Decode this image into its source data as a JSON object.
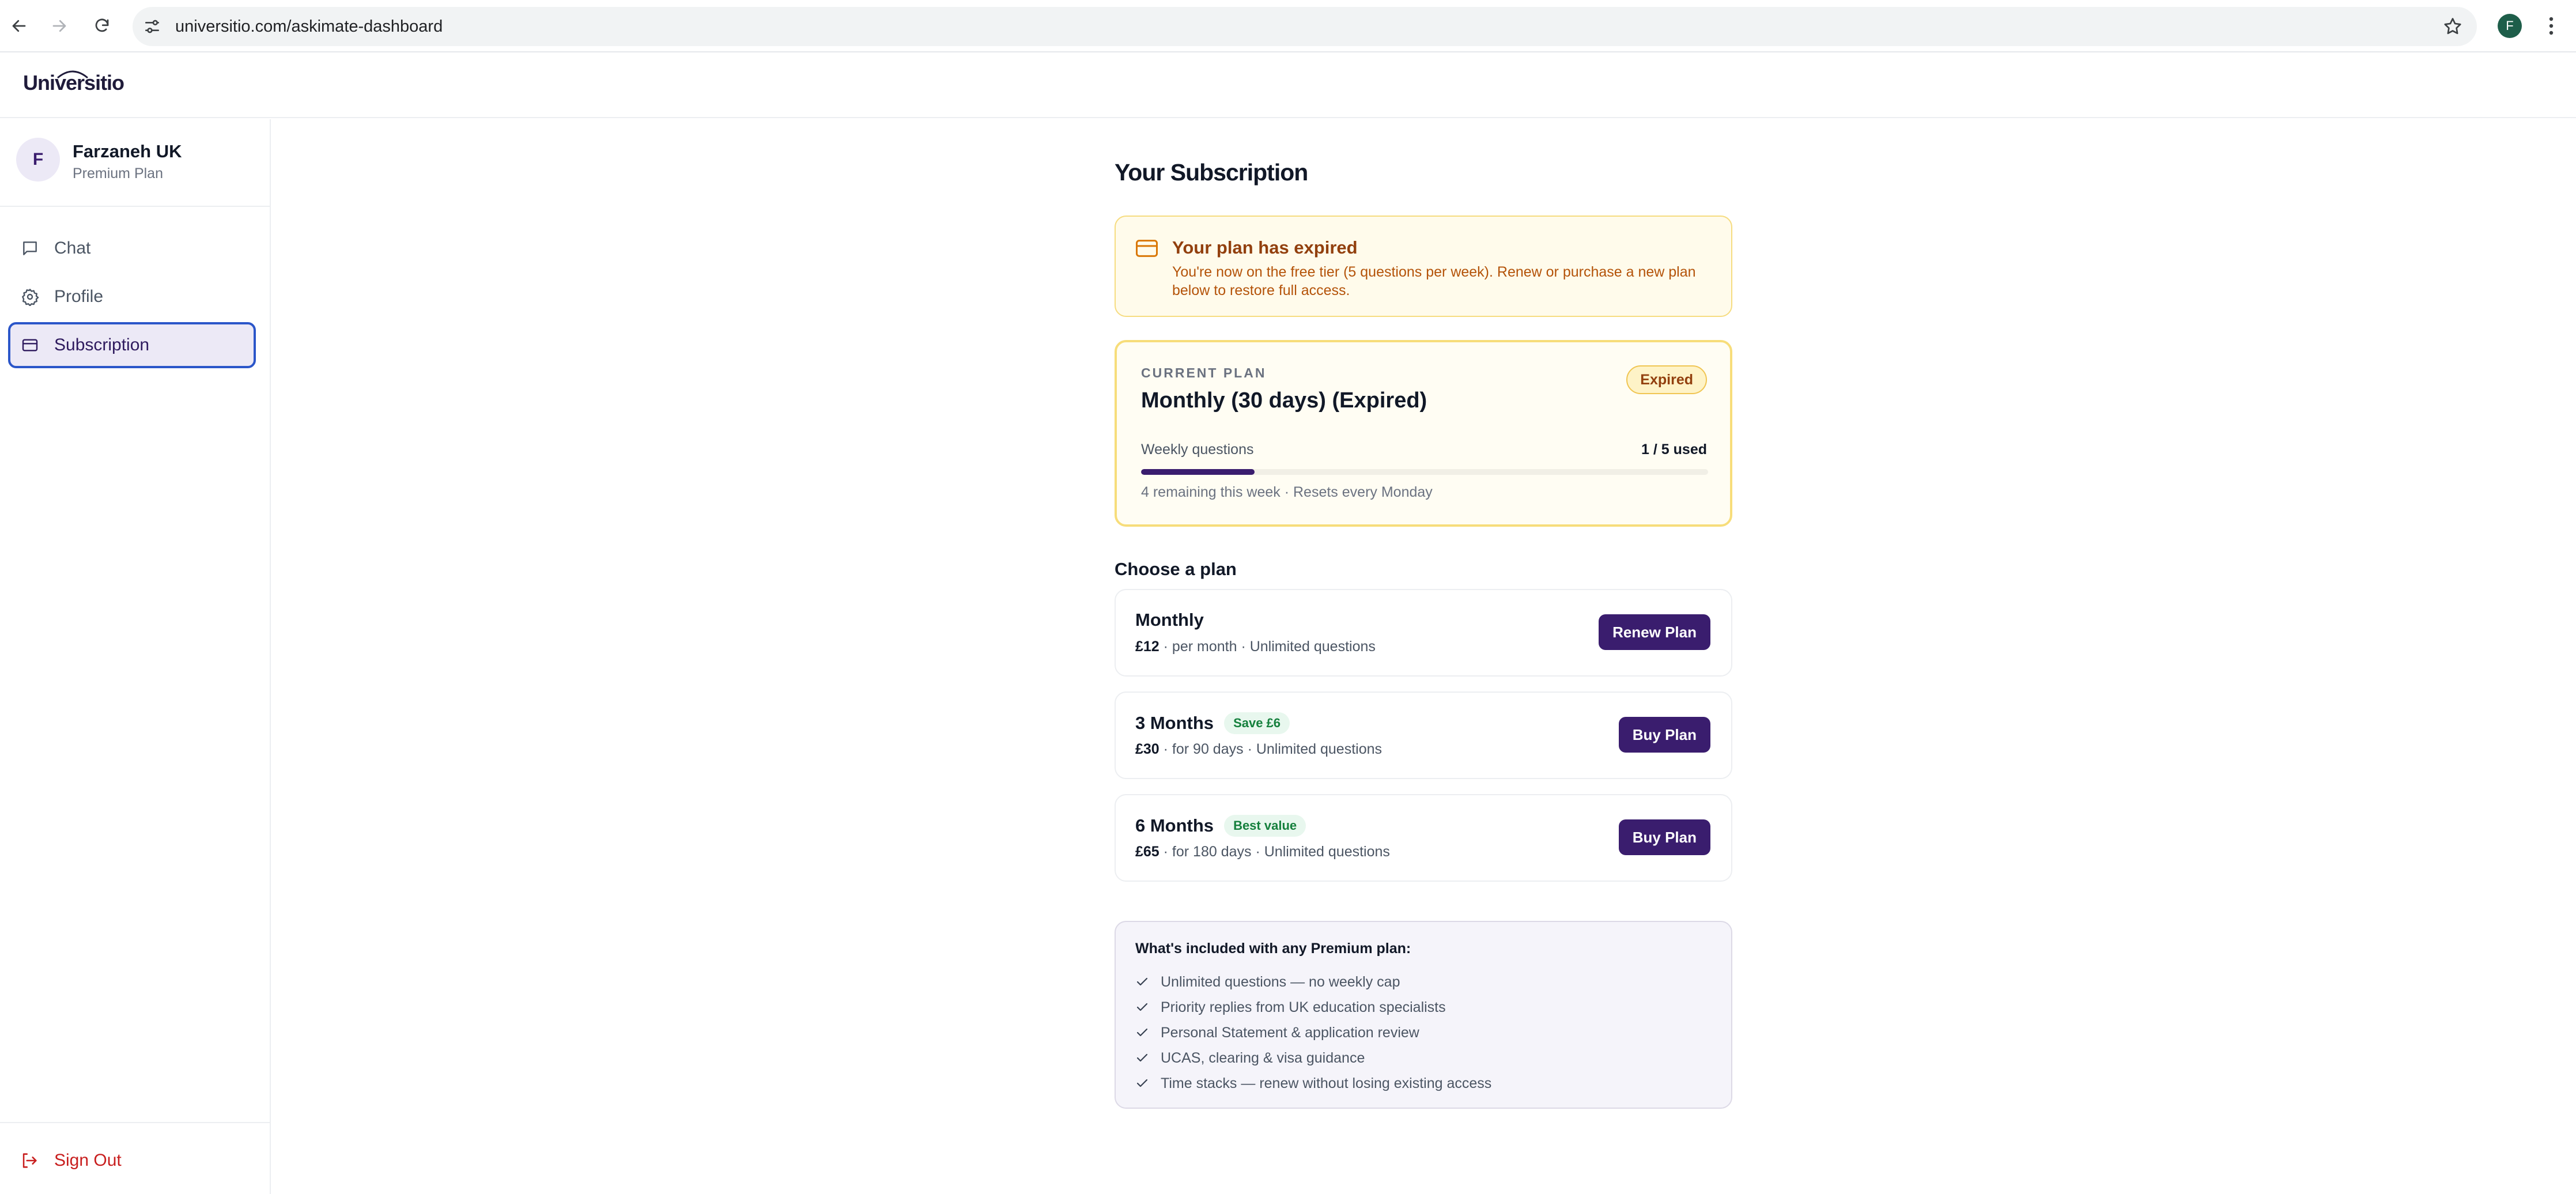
{
  "browser": {
    "url": "universitio.com/askimate-dashboard",
    "profile_initial": "F"
  },
  "app": {
    "logo": "Universitio"
  },
  "sidebar": {
    "user": {
      "initial": "F",
      "name": "Farzaneh UK",
      "plan": "Premium Plan"
    },
    "items": [
      {
        "label": "Chat",
        "icon": "chat-bubble-icon"
      },
      {
        "label": "Profile",
        "icon": "gear-icon"
      },
      {
        "label": "Subscription",
        "icon": "credit-card-icon"
      }
    ],
    "signout_label": "Sign Out"
  },
  "subscription": {
    "title": "Your Subscription",
    "alert": {
      "title": "Your plan has expired",
      "body": "You're now on the free tier (5 questions per week). Renew or purchase a new plan below to restore full access."
    },
    "current_plan": {
      "kicker": "CURRENT PLAN",
      "name": "Monthly (30 days) (Expired)",
      "status": "Expired",
      "usage_label": "Weekly questions",
      "usage_count": "1 / 5 used",
      "usage_fraction": 0.2,
      "usage_note": "4 remaining this week · Resets every Monday"
    },
    "choose_title": "Choose a plan",
    "plans": [
      {
        "name": "Monthly",
        "tag": "",
        "price": "£12",
        "details": " · per month · Unlimited questions",
        "button": "Renew Plan"
      },
      {
        "name": "3 Months",
        "tag": "Save £6",
        "price": "£30",
        "details": " · for 90 days · Unlimited questions",
        "button": "Buy Plan"
      },
      {
        "name": "6 Months",
        "tag": "Best value",
        "price": "£65",
        "details": " · for 180 days · Unlimited questions",
        "button": "Buy Plan"
      }
    ],
    "benefits": {
      "title": "What's included with any Premium plan:",
      "items": [
        "Unlimited questions — no weekly cap",
        "Priority replies from UK education specialists",
        "Personal Statement & application review",
        "UCAS, clearing & visa guidance",
        "Time stacks — renew without losing existing access"
      ]
    }
  },
  "colors": {
    "brand": "#3a1d6e",
    "warning_bg": "#fffbeb",
    "warning_border": "#f6dc80",
    "danger": "#c81e1e",
    "success": "#15803d"
  }
}
